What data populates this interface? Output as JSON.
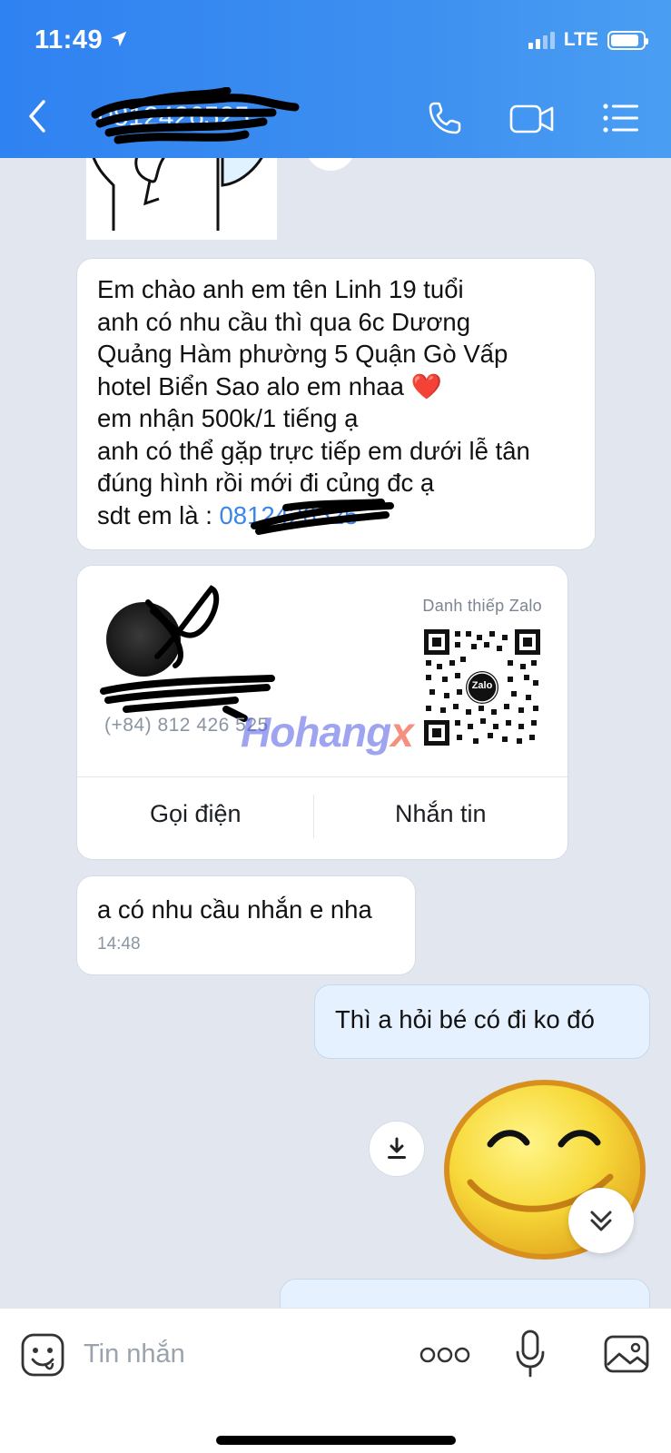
{
  "status_bar": {
    "time": "11:49",
    "network": "LTE"
  },
  "header": {
    "contact_name": "0812426525"
  },
  "messages": {
    "intro": "Em chào anh em tên Linh 19 tuổi\nanh có nhu cầu thì qua 6c Dương\nQuảng Hàm phường 5 Quận Gò Vấp\nhotel Biển Sao alo em nhaa ❤️\nem nhận 500k/1 tiếng ạ\nanh có thể gặp trực tiếp em dưới lễ tân\nđúng hình rồi mới đi củng đc ạ\nsdt em là : ",
    "intro_phone": "0812426525",
    "card": {
      "label": "Danh thiếp Zalo",
      "phone": "(+84) 812 426 525",
      "call_label": "Gọi điện",
      "message_label": "Nhắn tin",
      "watermark_main": "Hohang",
      "watermark_accent": "x",
      "qr_logo": "Zalo"
    },
    "reply_in": "a có nhu cầu nhắn e nha",
    "reply_in_time": "14:48",
    "reply_out": "Thì a hỏi bé có đi ko đó"
  },
  "input": {
    "placeholder": "Tin nhắn"
  },
  "colors": {
    "header_blue": "#3d8ff0",
    "outgoing_bubble": "#e5f1fe",
    "link_blue": "#3a86e8"
  }
}
